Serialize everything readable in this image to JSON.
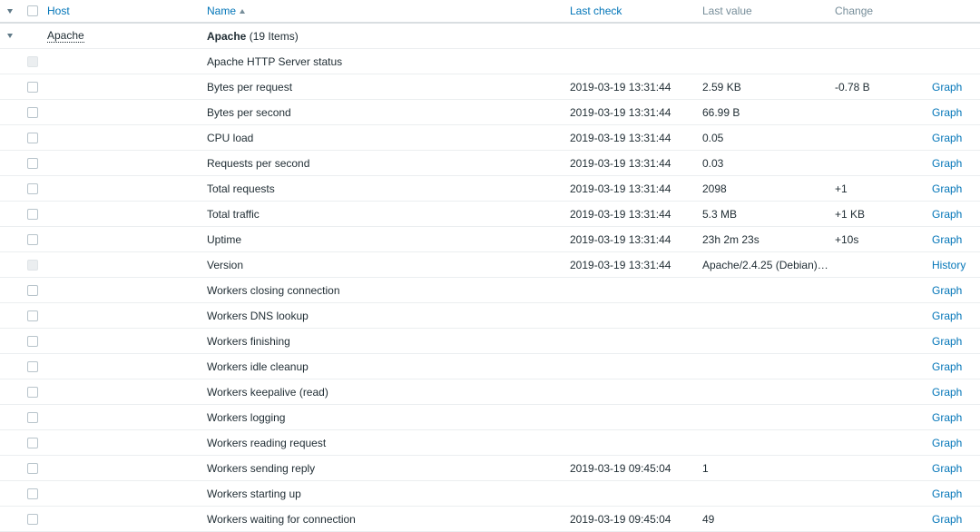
{
  "header": {
    "host": "Host",
    "name": "Name",
    "last_check": "Last check",
    "last_value": "Last value",
    "change": "Change"
  },
  "group": {
    "host": "Apache",
    "name": "Apache",
    "count": "(19 Items)"
  },
  "items": [
    {
      "name": "Apache HTTP Server status",
      "last_check": "",
      "last_value": "",
      "change": "",
      "action": "",
      "checkbox_disabled": true
    },
    {
      "name": "Bytes per request",
      "last_check": "2019-03-19 13:31:44",
      "last_value": "2.59 KB",
      "change": "-0.78 B",
      "action": "Graph",
      "checkbox_disabled": false
    },
    {
      "name": "Bytes per second",
      "last_check": "2019-03-19 13:31:44",
      "last_value": "66.99 B",
      "change": "",
      "action": "Graph",
      "checkbox_disabled": false
    },
    {
      "name": "CPU load",
      "last_check": "2019-03-19 13:31:44",
      "last_value": "0.05",
      "change": "",
      "action": "Graph",
      "checkbox_disabled": false
    },
    {
      "name": "Requests per second",
      "last_check": "2019-03-19 13:31:44",
      "last_value": "0.03",
      "change": "",
      "action": "Graph",
      "checkbox_disabled": false
    },
    {
      "name": "Total requests",
      "last_check": "2019-03-19 13:31:44",
      "last_value": "2098",
      "change": "+1",
      "action": "Graph",
      "checkbox_disabled": false
    },
    {
      "name": "Total traffic",
      "last_check": "2019-03-19 13:31:44",
      "last_value": "5.3 MB",
      "change": "+1 KB",
      "action": "Graph",
      "checkbox_disabled": false
    },
    {
      "name": "Uptime",
      "last_check": "2019-03-19 13:31:44",
      "last_value": "23h 2m 23s",
      "change": "+10s",
      "action": "Graph",
      "checkbox_disabled": false
    },
    {
      "name": "Version",
      "last_check": "2019-03-19 13:31:44",
      "last_value": "Apache/2.4.25 (Debian) ...",
      "change": "",
      "action": "History",
      "checkbox_disabled": true
    },
    {
      "name": "Workers closing connection",
      "last_check": "",
      "last_value": "",
      "change": "",
      "action": "Graph",
      "checkbox_disabled": false
    },
    {
      "name": "Workers DNS lookup",
      "last_check": "",
      "last_value": "",
      "change": "",
      "action": "Graph",
      "checkbox_disabled": false
    },
    {
      "name": "Workers finishing",
      "last_check": "",
      "last_value": "",
      "change": "",
      "action": "Graph",
      "checkbox_disabled": false
    },
    {
      "name": "Workers idle cleanup",
      "last_check": "",
      "last_value": "",
      "change": "",
      "action": "Graph",
      "checkbox_disabled": false
    },
    {
      "name": "Workers keepalive (read)",
      "last_check": "",
      "last_value": "",
      "change": "",
      "action": "Graph",
      "checkbox_disabled": false
    },
    {
      "name": "Workers logging",
      "last_check": "",
      "last_value": "",
      "change": "",
      "action": "Graph",
      "checkbox_disabled": false
    },
    {
      "name": "Workers reading request",
      "last_check": "",
      "last_value": "",
      "change": "",
      "action": "Graph",
      "checkbox_disabled": false
    },
    {
      "name": "Workers sending reply",
      "last_check": "2019-03-19 09:45:04",
      "last_value": "1",
      "change": "",
      "action": "Graph",
      "checkbox_disabled": false
    },
    {
      "name": "Workers starting up",
      "last_check": "",
      "last_value": "",
      "change": "",
      "action": "Graph",
      "checkbox_disabled": false
    },
    {
      "name": "Workers waiting for connection",
      "last_check": "2019-03-19 09:45:04",
      "last_value": "49",
      "change": "",
      "action": "Graph",
      "checkbox_disabled": false
    }
  ],
  "icons": {
    "toggle": "chevron-down-icon",
    "sort": "sort-ascending-icon"
  },
  "colors": {
    "link": "#0275b8",
    "header_text": "#768d99",
    "text": "#1f2c33"
  }
}
